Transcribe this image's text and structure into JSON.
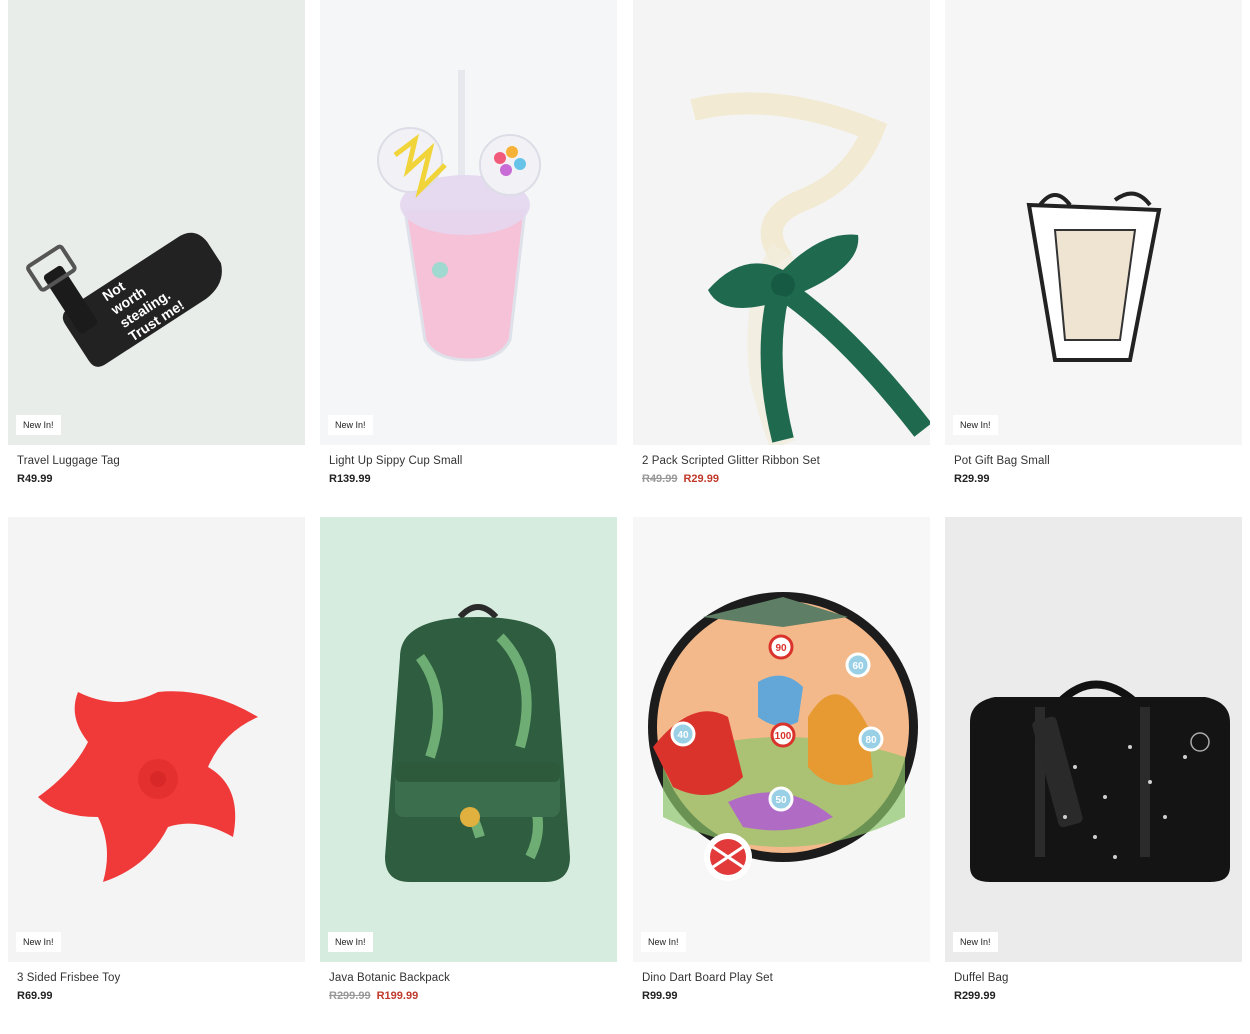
{
  "badge_label": "New In!",
  "products": [
    {
      "name": "Travel Luggage Tag",
      "price": "R49.99",
      "icon": "luggage-tag-image",
      "tag_text": [
        "Not",
        "worth",
        "stealing.",
        "Trust me!"
      ]
    },
    {
      "name": "Light Up Sippy Cup Small",
      "price": "R139.99",
      "icon": "sippy-cup-image"
    },
    {
      "name": "2 Pack Scripted Glitter Ribbon Set",
      "old_price": "R49.99",
      "sale_price": "R29.99",
      "icon": "ribbon-image"
    },
    {
      "name": "Pot Gift Bag Small",
      "price": "R29.99",
      "icon": "gift-bag-image"
    },
    {
      "name": "3 Sided Frisbee Toy",
      "price": "R69.99",
      "icon": "frisbee-image"
    },
    {
      "name": "Java Botanic Backpack",
      "old_price": "R299.99",
      "sale_price": "R199.99",
      "icon": "backpack-image"
    },
    {
      "name": "Dino Dart Board Play Set",
      "price": "R99.99",
      "icon": "dart-board-image",
      "target_numbers": [
        "90",
        "60",
        "40",
        "100",
        "80",
        "50"
      ]
    },
    {
      "name": "Duffel Bag",
      "price": "R299.99",
      "icon": "duffel-bag-image"
    }
  ],
  "colors": {
    "sale": "#c0392b",
    "old_price": "#999999"
  }
}
